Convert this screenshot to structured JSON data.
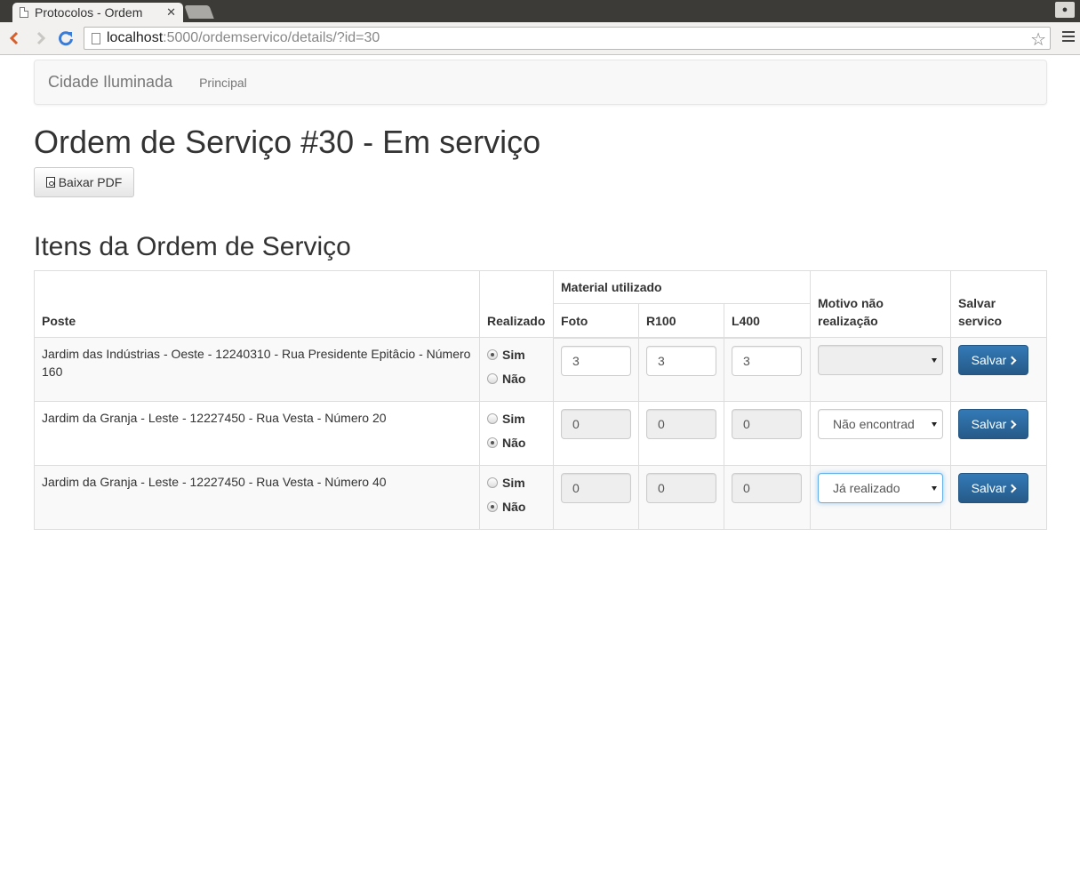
{
  "browser": {
    "tab_title": "Protocolos - Ordem",
    "url_host": "localhost",
    "url_path": ":5000/ordemservico/details/?id=30"
  },
  "navbar": {
    "brand": "Cidade Iluminada",
    "links": [
      "Principal"
    ]
  },
  "page": {
    "title": "Ordem de Serviço #30 - Em serviço",
    "pdf_button": "Baixar PDF",
    "section_title": "Itens da Ordem de Serviço"
  },
  "table": {
    "headers": {
      "poste": "Poste",
      "realizado": "Realizado",
      "material": "Material utilizado",
      "foto": "Foto",
      "r100": "R100",
      "l400": "L400",
      "motivo": "Motivo não realização",
      "salvar": "Salvar servico"
    },
    "radio_sim": "Sim",
    "radio_nao": "Não",
    "save_label": "Salvar",
    "rows": [
      {
        "poste": "Jardim das Indústrias - Oeste - 12240310 - Rua Presidente Epitâcio - Número 160",
        "realizado": "sim",
        "foto": "3",
        "r100": "3",
        "l400": "3",
        "motivo": "",
        "motivo_disabled": true
      },
      {
        "poste": "Jardim da Granja - Leste - 12227450 - Rua Vesta - Número 20",
        "realizado": "nao",
        "foto": "0",
        "r100": "0",
        "l400": "0",
        "motivo": "Não encontrad",
        "motivo_disabled": false
      },
      {
        "poste": "Jardim da Granja - Leste - 12227450 - Rua Vesta - Número 40",
        "realizado": "nao",
        "foto": "0",
        "r100": "0",
        "l400": "0",
        "motivo": "Já realizado",
        "motivo_disabled": false
      }
    ]
  }
}
